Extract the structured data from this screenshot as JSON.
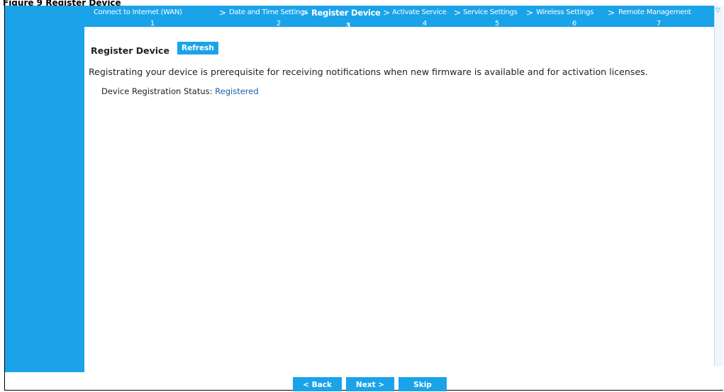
{
  "figure_title": "Figure 9 Register Device",
  "wizard": {
    "steps": [
      {
        "label": "Connect to Internet (WAN)",
        "number": "1"
      },
      {
        "label": "Date and Time Settings",
        "number": "2"
      },
      {
        "label": "Register Device",
        "number": "3",
        "active": true
      },
      {
        "label": "Activate Service",
        "number": "4"
      },
      {
        "label": "Service Settings",
        "number": "5"
      },
      {
        "label": "Wireless Settings",
        "number": "6"
      },
      {
        "label": "Remote Management",
        "number": "7"
      }
    ],
    "separator": ">"
  },
  "main": {
    "title": "Register Device",
    "refresh_label": "Refresh",
    "intro": "Registrating your device is prerequisite for receiving notifications when new firmware is available and for activation licenses.",
    "status_label": "Device Registration Status:",
    "status_value": "Registered"
  },
  "footer": {
    "back_label": "< Back",
    "next_label": "Next >",
    "skip_label": "Skip"
  },
  "icons": {
    "rail_icon": "filter-icon"
  },
  "colors": {
    "accent": "#1aa3e8",
    "status_value": "#1a5fa8",
    "text": "#222222"
  }
}
